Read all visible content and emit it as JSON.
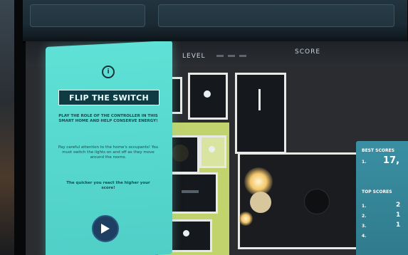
{
  "panel": {
    "icon": "info-icon",
    "title": "FLIP THE SWITCH",
    "intro": "PLAY THE ROLE OF THE CONTROLLER IN THIS SMART HOME AND HELP CONSERVE ENERGY!",
    "instructions": "Pay careful attention to the home's occupants! You must switch the lights on and off as they move around the rooms.",
    "tip": "The quicker you react the higher your score!",
    "play_icon": "play-icon"
  },
  "topbar": {
    "level_label": "LEVEL",
    "score_label": "SCORE"
  },
  "scoreboard": {
    "best_title": "BEST SCORES",
    "best": {
      "rank": "1.",
      "value": "17,"
    },
    "top_title": "TOP SCORES",
    "rows": [
      {
        "rank": "1.",
        "value": "2"
      },
      {
        "rank": "2.",
        "value": "1"
      },
      {
        "rank": "3.",
        "value": "1"
      },
      {
        "rank": "4.",
        "value": ""
      }
    ]
  },
  "colors": {
    "panel": "#5fe1d6",
    "title_box": "#0f3b44",
    "play_button": "#1e3e62",
    "floor_highlight": "#c1d36d",
    "scoreboard": "#3a8fa2"
  }
}
